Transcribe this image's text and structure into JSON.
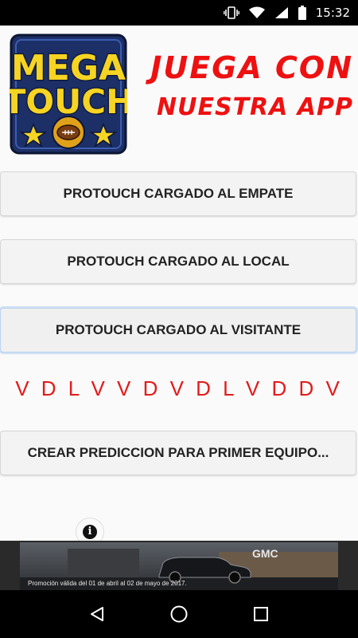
{
  "status_bar": {
    "time": "15:32"
  },
  "header": {
    "logo": {
      "line1": "MEGA",
      "line2": "TOUCH"
    },
    "slogan": {
      "line1": "JUEGA CON",
      "line2": "NUESTRA APP"
    }
  },
  "buttons": {
    "empate": "PROTOUCH CARGADO AL EMPATE",
    "local": "PROTOUCH CARGADO AL LOCAL",
    "visitante": "PROTOUCH CARGADO AL VISITANTE",
    "crear": "CREAR PREDICCION PARA PRIMER EQUIPO..."
  },
  "prediction": "V D L V V D V D L V D D V",
  "info": {
    "label": "i"
  },
  "ad": {
    "brand": "GMC",
    "disclaimer": "Promoción válida del 01 de abril al 02 de mayo de 2017."
  },
  "colors": {
    "accent_red": "#e21b1b",
    "logo_yellow": "#f6d423",
    "logo_blue": "#1c2f66"
  },
  "icons": [
    "vibrate-icon",
    "wifi-icon",
    "signal-icon",
    "battery-icon",
    "back-icon",
    "home-icon",
    "recents-icon",
    "info-icon",
    "star-icon",
    "football-icon"
  ]
}
